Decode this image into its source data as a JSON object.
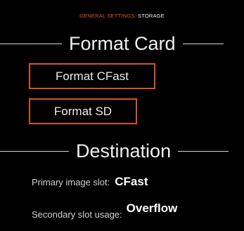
{
  "breadcrumb": {
    "parent": "GENERAL SETTINGS:",
    "current": "STORAGE"
  },
  "format_card": {
    "title": "Format Card",
    "buttons": {
      "cfast": "Format CFast",
      "sd": "Format SD"
    }
  },
  "destination": {
    "title": "Destination",
    "primary_slot": {
      "label": "Primary image slot:",
      "value": "CFast"
    },
    "secondary_usage": {
      "label": "Secondary slot usage:",
      "value": "Overflow"
    }
  },
  "colors": {
    "background": "#000000",
    "accent": "#d2561f",
    "text": "#e6e6e6"
  }
}
